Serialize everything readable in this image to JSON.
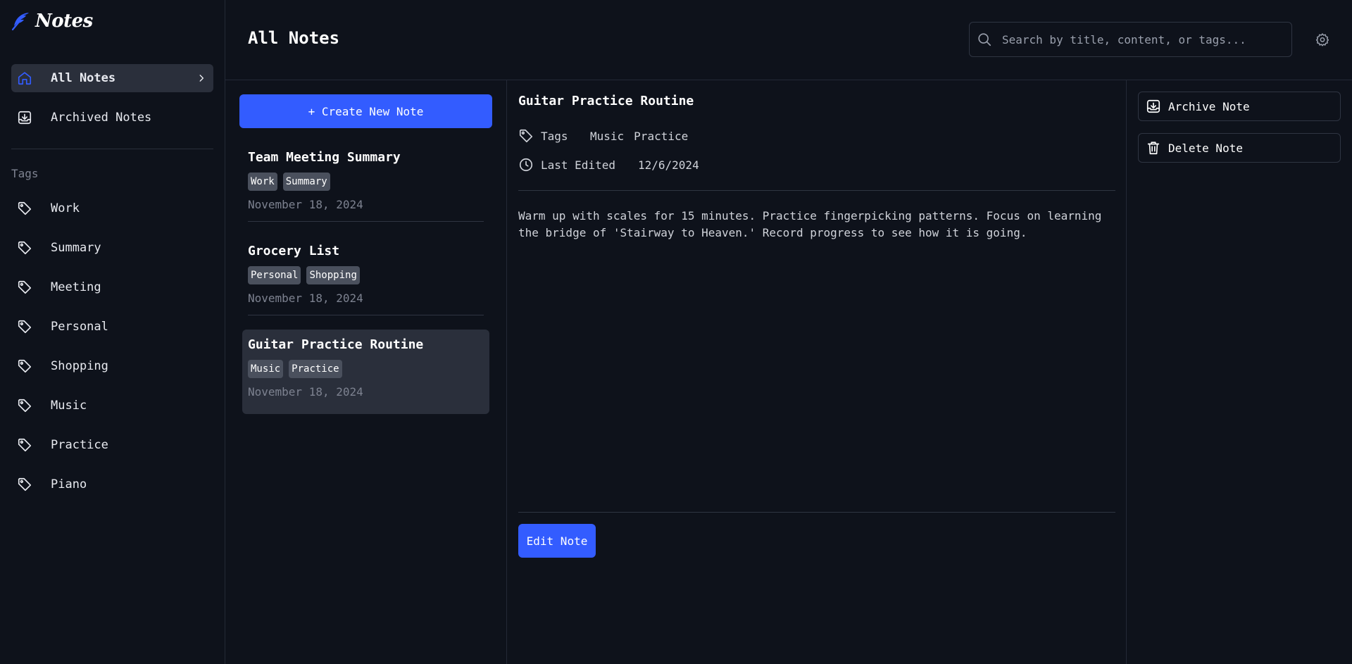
{
  "app": {
    "name": "Notes",
    "logo_icon": "feather-icon"
  },
  "sidebar": {
    "nav": [
      {
        "label": "All Notes",
        "icon": "home-icon",
        "active": true
      },
      {
        "label": "Archived Notes",
        "icon": "archive-icon",
        "active": false
      }
    ],
    "tags_heading": "Tags",
    "tags": [
      "Work",
      "Summary",
      "Meeting",
      "Personal",
      "Shopping",
      "Music",
      "Practice",
      "Piano"
    ]
  },
  "header": {
    "title": "All Notes",
    "search_placeholder": "Search by title, content, or tags..."
  },
  "notes_list": {
    "create_label": "+ Create New Note",
    "notes": [
      {
        "title": "Team Meeting Summary",
        "tags": [
          "Work",
          "Summary"
        ],
        "date": "November 18, 2024"
      },
      {
        "title": "Grocery List",
        "tags": [
          "Personal",
          "Shopping"
        ],
        "date": "November 18, 2024"
      },
      {
        "title": "Guitar Practice Routine",
        "tags": [
          "Music",
          "Practice"
        ],
        "date": "November 18, 2024",
        "selected": true
      }
    ]
  },
  "detail": {
    "title": "Guitar Practice Routine",
    "tags_label": "Tags",
    "tags": [
      "Music",
      "Practice"
    ],
    "last_edited_label": "Last Edited",
    "last_edited": "12/6/2024",
    "body": "Warm up with scales for 15 minutes. Practice fingerpicking patterns. Focus on learning\nthe bridge of 'Stairway to Heaven.' Record progress to see how it is going.",
    "edit_label": "Edit Note"
  },
  "actions": {
    "archive_label": "Archive Note",
    "delete_label": "Delete Note"
  },
  "colors": {
    "background": "#0e121b",
    "accent": "#335cff",
    "selected_bg": "#2a2f3b",
    "chip_bg": "#4a505d"
  }
}
